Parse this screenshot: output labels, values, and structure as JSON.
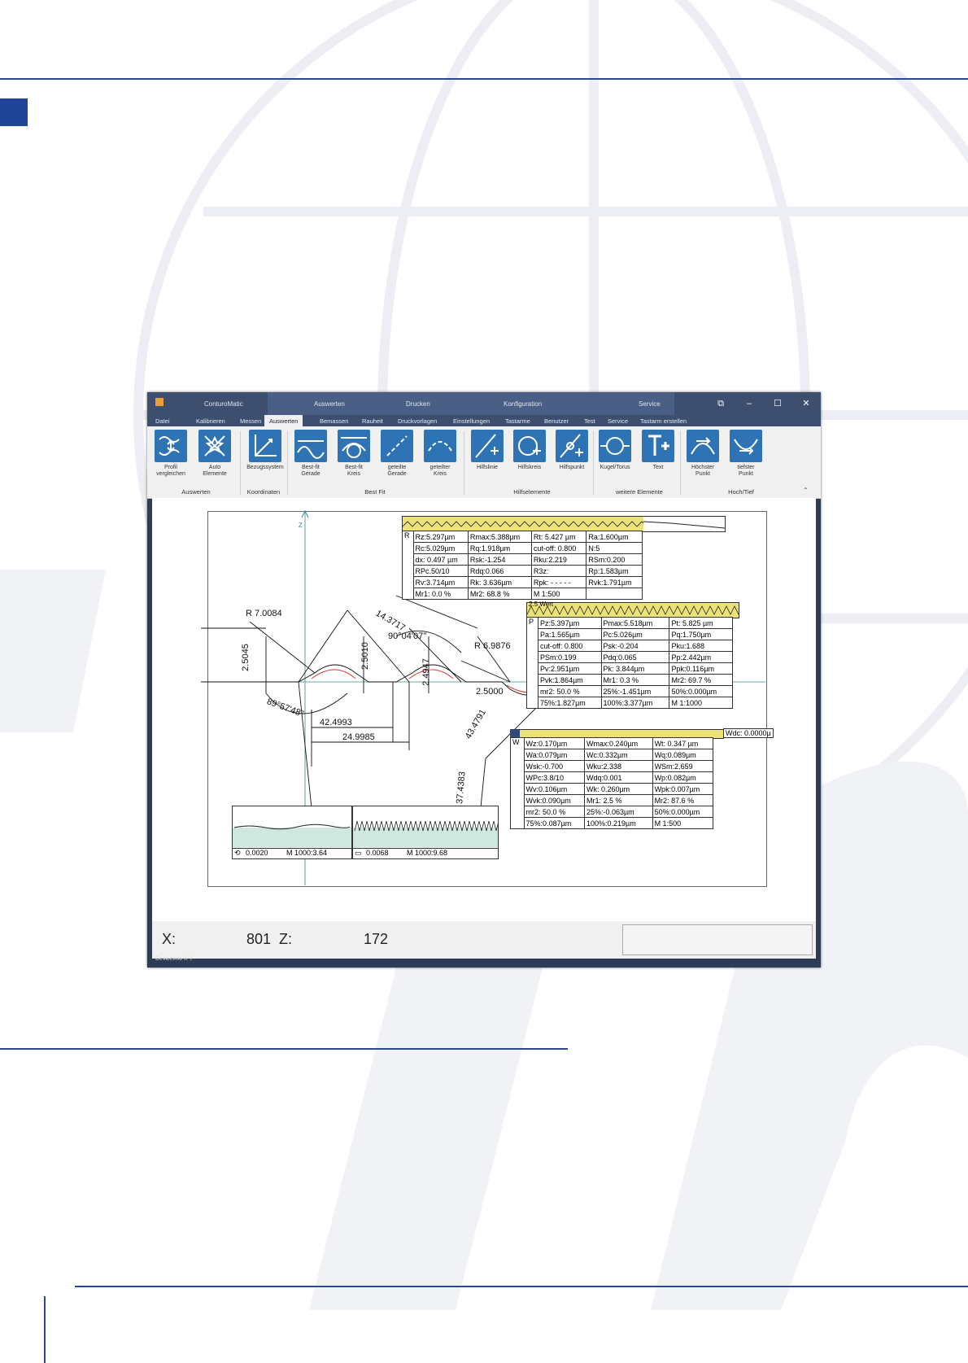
{
  "window": {
    "title": "ConturoMatic",
    "context_tabs": [
      "Auswerten",
      "Drucken",
      "Konfiguration",
      "Service"
    ]
  },
  "tabs": [
    "Datei",
    "Kalibrieren",
    "Messen",
    "Auswerten",
    "Bemassen",
    "Rauheit",
    "Druckvorlagen",
    "Einstellungen",
    "Tastarme",
    "Benutzer",
    "Test",
    "Service",
    "Tastarm erstellen"
  ],
  "ribbon": {
    "buttons": [
      {
        "label1": "Profil",
        "label2": "vergleichen",
        "icon": "profile-compare-icon"
      },
      {
        "label1": "Auto",
        "label2": "Elemente",
        "icon": "auto-elements-icon"
      },
      {
        "label1": "Bezugssystem",
        "label2": "",
        "icon": "coordinate-system-icon"
      },
      {
        "label1": "Best-fit",
        "label2": "Gerade",
        "icon": "best-fit-line-icon"
      },
      {
        "label1": "Best-fit",
        "label2": "Kreis",
        "icon": "best-fit-circle-icon"
      },
      {
        "label1": "geteilte",
        "label2": "Gerade",
        "icon": "split-line-icon"
      },
      {
        "label1": "geteilter",
        "label2": "Kreis",
        "icon": "split-circle-icon"
      },
      {
        "label1": "Hilfslinie",
        "label2": "",
        "icon": "help-line-icon"
      },
      {
        "label1": "Hilfskreis",
        "label2": "",
        "icon": "help-circle-icon"
      },
      {
        "label1": "Hilfspunkt",
        "label2": "",
        "icon": "help-point-icon"
      },
      {
        "label1": "Kugel/Torus",
        "label2": "",
        "icon": "sphere-torus-icon"
      },
      {
        "label1": "Text",
        "label2": "",
        "icon": "text-icon"
      },
      {
        "label1": "Höchster",
        "label2": "Punkt",
        "icon": "highest-point-icon"
      },
      {
        "label1": "tiefster",
        "label2": "Punkt",
        "icon": "lowest-point-icon"
      }
    ],
    "groups": [
      "Auswerten",
      "Koordinaten",
      "Best Fit",
      "Hilfselemente",
      "weitere Elemente",
      "Hoch/Tief"
    ]
  },
  "drawing": {
    "axis_label": "Z",
    "dimensions": [
      "R 7.0084",
      "14.3717",
      "90°04'07''",
      "2.5045",
      "2.5010",
      "2.4947",
      "R 6.9876",
      "2.5000",
      "89°57'48''",
      "42.4993",
      "24.9985",
      "43.4791",
      "37.4383"
    ],
    "table_R": [
      [
        "Rz:5.297µm",
        "Rmax:5.388µm",
        "Rt: 5.427 µm",
        "Ra:1.600µm"
      ],
      [
        "Rc:5.029µm",
        "Rq:1.918µm",
        "cut-off: 0.800",
        "N:5"
      ],
      [
        "dx: 0.497 µm",
        "Rsk:-1.254",
        "Rku:2.219",
        "RSm:0.200"
      ],
      [
        "RPc.50/10",
        "Rdq:0.066",
        "R3z:",
        "Rp:1.583µm"
      ],
      [
        "Rv:3.714µm",
        "Rk: 3.636µm",
        "Rpk: - - - - -",
        "Rvk:1.791µm"
      ],
      [
        "Mr1: 0.0 %",
        "Mr2: 68.8 %",
        "M 1:500",
        ""
      ]
    ],
    "table_P": [
      [
        "Pz:5.397µm",
        "Pmax:5.518µm",
        "Pt: 5.825 µm"
      ],
      [
        "Pa:1.565µm",
        "Pc:5.026µm",
        "Pq:1.750µm"
      ],
      [
        "cut-off: 0.800",
        "Psk:-0.204",
        "Pku:1.688"
      ],
      [
        "PSm:0.199",
        "Pdq:0.065",
        "Pp:2.442µm"
      ],
      [
        "Pv:2.951µm",
        "Pk: 3.844µm",
        "Ppk:0.116µm"
      ],
      [
        "Pvk:1.864µm",
        "Mr1: 0.3 %",
        "Mr2: 69.7 %"
      ],
      [
        "mr2: 50.0 %",
        "25%:-1.451µm",
        "50%:0.000µm"
      ],
      [
        "75%:1.827µm",
        "100%:3.377µm",
        "M 1:1000"
      ]
    ],
    "table_W": [
      [
        "Wz:0.170µm",
        "Wmax:0.240µm",
        "Wt: 0.347 µm"
      ],
      [
        "Wa:0.079µm",
        "Wc:0.332µm",
        "Wq:0.089µm"
      ],
      [
        "Wsk:-0.700",
        "Wku:2.338",
        "WSm:2.659"
      ],
      [
        "WPc:3.8/10",
        "Wdq:0.001",
        "Wp:0.082µm"
      ],
      [
        "Wv:0.106µm",
        "Wk: 0.260µm",
        "Wpk:0.007µm"
      ],
      [
        "Wvk:0.090µm",
        "Mr1: 2.5 %",
        "Mr2: 87.6 %"
      ],
      [
        "mr2: 50.0 %",
        "25%:-0.063µm",
        "50%:0.000µm"
      ],
      [
        "75%:0.087µm",
        "100%:0.219µm",
        "M 1:500"
      ]
    ],
    "p_prefix": "P",
    "w_prefix": "W",
    "r_prefix": "R",
    "p_header": "2.5 Wert",
    "p_header_small": "2.5",
    "w_side": "Wdc: 0.0000µ",
    "mini1": {
      "value": "0.0020",
      "scale": "M 1000:3.64"
    },
    "mini2": {
      "value": "0.0068",
      "scale": "M 1000:9.68"
    }
  },
  "status": {
    "x_label": "X:",
    "x_value": "801",
    "z_label": "Z:",
    "z_value": "172",
    "device_info": "DeviceInfo   X   Y"
  }
}
